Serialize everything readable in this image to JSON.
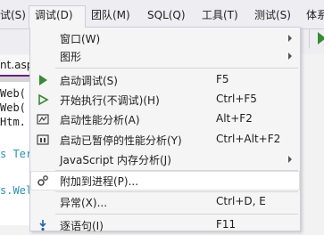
{
  "menubar": {
    "items": [
      {
        "label": "试(S)"
      },
      {
        "label": "调试(D)"
      },
      {
        "label": "团队(M)"
      },
      {
        "label": "SQL(Q)"
      },
      {
        "label": "工具(T)"
      },
      {
        "label": "测试(S)"
      },
      {
        "label": "体系"
      }
    ]
  },
  "editor": {
    "tab_label": "nt.asp",
    "code_lines": [
      {
        "text": "Web(",
        "color": "#1e1e1e"
      },
      {
        "text": "Web(",
        "color": "#1e1e1e"
      },
      {
        "text": "Htm.",
        "color": "#1e1e1e"
      },
      {
        "text": "s Ter",
        "color": "#2b91af"
      },
      {
        "text": "s.Wel",
        "color": "#2b91af"
      }
    ]
  },
  "dropdown": {
    "items": [
      {
        "label": "窗口(W)",
        "shortcut": "",
        "submenu": true,
        "icon": ""
      },
      {
        "label": "图形",
        "shortcut": "",
        "submenu": true,
        "icon": ""
      },
      {
        "label": "启动调试(S)",
        "shortcut": "F5",
        "submenu": false,
        "icon": "play-icon"
      },
      {
        "label": "开始执行(不调试)(H)",
        "shortcut": "Ctrl+F5",
        "submenu": false,
        "icon": "play-outline-icon"
      },
      {
        "label": "启动性能分析(A)",
        "shortcut": "Alt+F2",
        "submenu": false,
        "icon": "profiler-icon"
      },
      {
        "label": "启动已暂停的性能分析(Y)",
        "shortcut": "Ctrl+Alt+F2",
        "submenu": false,
        "icon": "profiler-paused-icon"
      },
      {
        "label": "JavaScript 内存分析(J)",
        "shortcut": "",
        "submenu": true,
        "icon": ""
      },
      {
        "label": "附加到进程(P)...",
        "shortcut": "",
        "submenu": false,
        "icon": "gears-icon"
      },
      {
        "label": "异常(X)...",
        "shortcut": "Ctrl+D, E",
        "submenu": false,
        "icon": ""
      },
      {
        "label": "逐语句(I)",
        "shortcut": "F11",
        "submenu": false,
        "icon": "step-into-icon"
      }
    ]
  },
  "colors": {
    "accent": "#68217a",
    "play_green": "#388a34",
    "menu_bg": "#f5f5f5",
    "border": "#cccedb"
  }
}
